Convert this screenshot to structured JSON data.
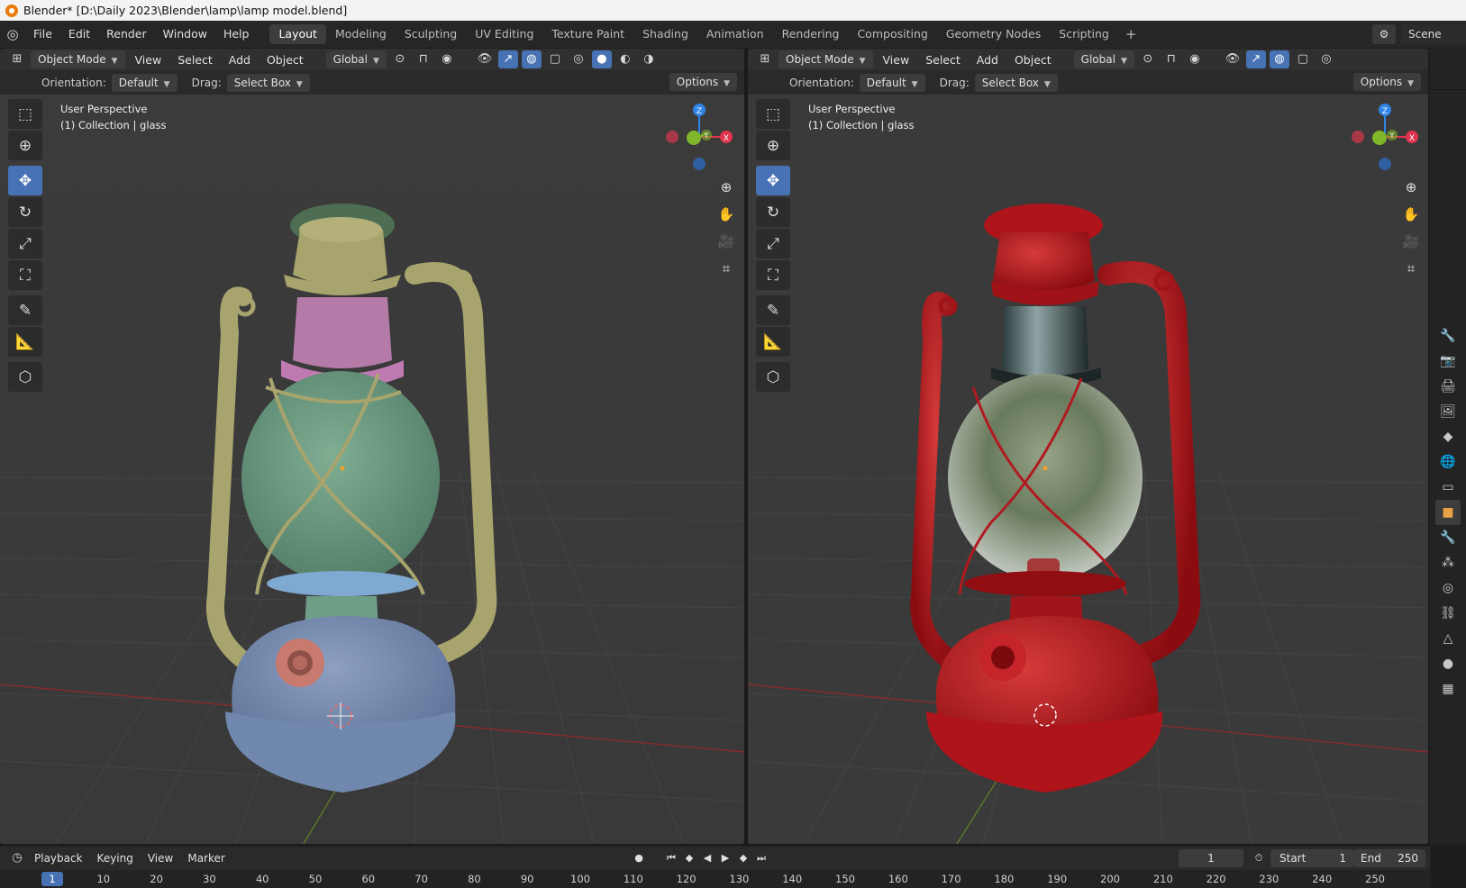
{
  "window": {
    "title": "Blender* [D:\\Daily 2023\\Blender\\lamp\\lamp model.blend]"
  },
  "menu": [
    "File",
    "Edit",
    "Render",
    "Window",
    "Help"
  ],
  "workspaces": [
    "Layout",
    "Modeling",
    "Sculpting",
    "UV Editing",
    "Texture Paint",
    "Shading",
    "Animation",
    "Rendering",
    "Compositing",
    "Geometry Nodes",
    "Scripting"
  ],
  "active_workspace": "Layout",
  "scene": "Scene",
  "viewports": [
    {
      "mode": "Object Mode",
      "menus": [
        "View",
        "Select",
        "Add",
        "Object"
      ],
      "transform_orientation": "Global",
      "orientation_label": "Orientation:",
      "orientation_value": "Default",
      "drag_label": "Drag:",
      "drag_value": "Select Box",
      "options": "Options",
      "overlay_line1": "User Perspective",
      "overlay_line2": "(1) Collection | glass",
      "shading": "solid"
    },
    {
      "mode": "Object Mode",
      "menus": [
        "View",
        "Select",
        "Add",
        "Object"
      ],
      "transform_orientation": "Global",
      "orientation_label": "Orientation:",
      "orientation_value": "Default",
      "drag_label": "Drag:",
      "drag_value": "Select Box",
      "options": "Options",
      "overlay_line1": "User Perspective",
      "overlay_line2": "(1) Collection | glass",
      "shading": "material preview"
    }
  ],
  "gizmo_axes": {
    "z": "Z",
    "y": "Y",
    "x": "X"
  },
  "tools": [
    "select-box",
    "cursor",
    "move",
    "rotate",
    "scale",
    "transform",
    "annotate",
    "measure",
    "add-cube"
  ],
  "active_tool": "move",
  "timeline": {
    "menus": [
      "Playback",
      "Keying",
      "View",
      "Marker"
    ],
    "current_frame": "1",
    "start_label": "Start",
    "start": "1",
    "end_label": "End",
    "end": "250",
    "ruler_current": "1",
    "ruler_ticks": [
      "10",
      "20",
      "30",
      "40",
      "50",
      "60",
      "70",
      "80",
      "90",
      "100",
      "110",
      "120",
      "130",
      "140",
      "150",
      "160",
      "170",
      "180",
      "190",
      "200",
      "210",
      "220",
      "230",
      "240",
      "250"
    ]
  },
  "colors": {
    "accent": "#4772b3",
    "axis_x": "#e1344f",
    "axis_y": "#7fb62a",
    "axis_z": "#2f84e5",
    "lamp_frame_solid": "#a8a46d",
    "lamp_glass_solid": "#6d9a80",
    "lamp_base_solid": "#7088ad",
    "lamp_red": "#b0141b"
  }
}
